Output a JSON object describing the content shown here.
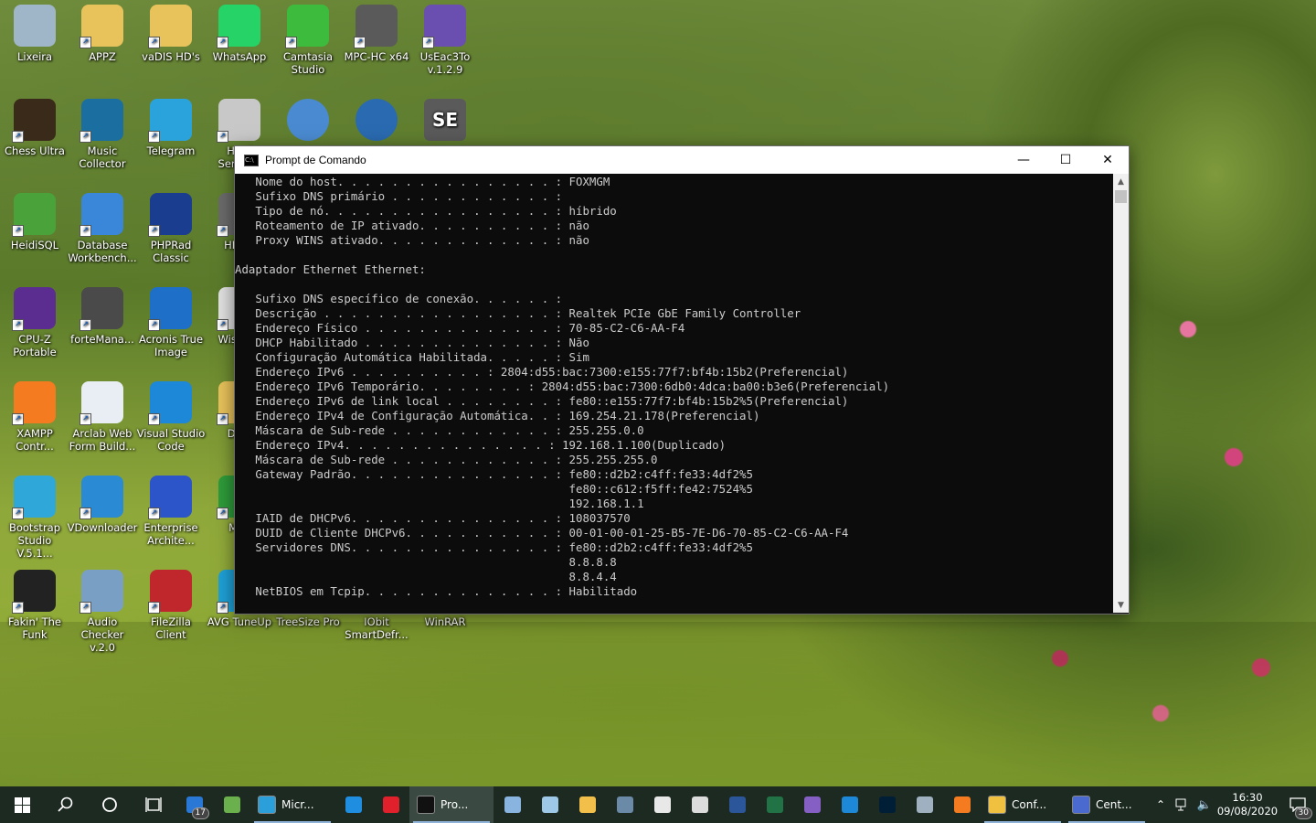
{
  "desktop": {
    "icons": [
      {
        "label": "Lixeira",
        "icon": "recycle-bin-icon",
        "color": "#9fb6c8"
      },
      {
        "label": "APPZ",
        "icon": "folder-icon",
        "color": "#e8c25a"
      },
      {
        "label": "vaDIS HD's",
        "icon": "folder-icon",
        "color": "#e8c25a"
      },
      {
        "label": "WhatsApp",
        "icon": "whatsapp-icon",
        "color": "#25d366"
      },
      {
        "label": "Camtasia Studio",
        "icon": "camtasia-icon",
        "color": "#3dbb3d"
      },
      {
        "label": "MPC-HC x64",
        "icon": "mpc-hc-icon",
        "color": "#5a5a5a"
      },
      {
        "label": "UsEac3To v.1.2.9",
        "icon": "useac3to-icon",
        "color": "#6a4fb0"
      },
      {
        "label": "Chess Ultra",
        "icon": "chess-icon",
        "color": "#3a2a1a"
      },
      {
        "label": "Music Collector",
        "icon": "music-collector-icon",
        "color": "#1a6fa0"
      },
      {
        "label": "Telegram",
        "icon": "telegram-icon",
        "color": "#2aa3dd"
      },
      {
        "label": "Hard Sentinel",
        "icon": "hard-disk-sentinel-icon",
        "color": "#c8c8c8"
      },
      {
        "label": "HeidiSQL",
        "icon": "heidisql-icon",
        "color": "#4aa33a"
      },
      {
        "label": "Database Workbench...",
        "icon": "database-workbench-icon",
        "color": "#3a86d9"
      },
      {
        "label": "PHPRad Classic",
        "icon": "phprad-icon",
        "color": "#1a3d8f"
      },
      {
        "label": "HD Tu",
        "icon": "hd-tune-icon",
        "color": "#6a6a6a"
      },
      {
        "label": "CPU-Z Portable",
        "icon": "cpu-z-icon",
        "color": "#5b2d91"
      },
      {
        "label": "forteMana...",
        "icon": "forte-manager-icon",
        "color": "#4a4a4a"
      },
      {
        "label": "Acronis True Image",
        "icon": "acronis-icon",
        "color": "#1e6fc7"
      },
      {
        "label": "Wise De",
        "icon": "wise-icon",
        "color": "#e0e0e0"
      },
      {
        "label": "XAMPP Contr...",
        "icon": "xampp-icon",
        "color": "#f47b20"
      },
      {
        "label": "Arclab Web Form Build...",
        "icon": "arclab-icon",
        "color": "#e8eef4"
      },
      {
        "label": "Visual Studio Code",
        "icon": "vscode-icon",
        "color": "#1e88d8"
      },
      {
        "label": "DirLi",
        "icon": "folder-icon",
        "color": "#e8c25a"
      },
      {
        "label": "Bootstrap Studio V.5.1...",
        "icon": "bootstrap-studio-icon",
        "color": "#2fa8d9"
      },
      {
        "label": "VDownloader",
        "icon": "vdownloader-icon",
        "color": "#2a8ad4"
      },
      {
        "label": "Enterprise Archite...",
        "icon": "enterprise-architect-icon",
        "color": "#2b55c9"
      },
      {
        "label": "Mak",
        "icon": "mak-icon",
        "color": "#2e9b3a"
      },
      {
        "label": "Fakin' The Funk",
        "icon": "fakin-the-funk-icon",
        "color": "#222222"
      },
      {
        "label": "Audio Checker v.2.0",
        "icon": "audio-checker-icon",
        "color": "#7a9fc4"
      },
      {
        "label": "FileZilla Client",
        "icon": "filezilla-icon",
        "color": "#c0272d"
      },
      {
        "label": "AVG TuneUp",
        "icon": "avg-tuneup-icon",
        "color": "#1ea0d6"
      },
      {
        "label": "TreeSize Pro",
        "icon": "treesize-icon",
        "color": "#4a8a2a"
      },
      {
        "label": "IObit SmartDefr...",
        "icon": "smart-defrag-icon",
        "color": "#3a7ab5"
      },
      {
        "label": "WinRAR",
        "icon": "winrar-icon",
        "color": "#8a3a7a"
      }
    ],
    "partial_icons": [
      {
        "icon": "media-player-icon",
        "color": "#4a8ad0"
      },
      {
        "icon": "media-center-icon",
        "color": "#2a6ab0"
      },
      {
        "icon": "se-explorer-icon",
        "color": "#5a5a5a",
        "text": "SE"
      }
    ]
  },
  "window": {
    "title": "Prompt de Comando",
    "minimize": "—",
    "maximize": "☐",
    "close": "✕",
    "lines": [
      "   Nome do host. . . . . . . . . . . . . . . . : FOXMGM",
      "   Sufixo DNS primário . . . . . . . . . . . . :",
      "   Tipo de nó. . . . . . . . . . . . . . . . . : híbrido",
      "   Roteamento de IP ativado. . . . . . . . . . : não",
      "   Proxy WINS ativado. . . . . . . . . . . . . : não",
      "",
      "Adaptador Ethernet Ethernet:",
      "",
      "   Sufixo DNS específico de conexão. . . . . . :",
      "   Descrição . . . . . . . . . . . . . . . . . : Realtek PCIe GbE Family Controller",
      "   Endereço Físico . . . . . . . . . . . . . . : 70-85-C2-C6-AA-F4",
      "   DHCP Habilitado . . . . . . . . . . . . . . : Não",
      "   Configuração Automática Habilitada. . . . . : Sim",
      "   Endereço IPv6 . . . . . . . . . . : 2804:d55:bac:7300:e155:77f7:bf4b:15b2(Preferencial)",
      "   Endereço IPv6 Temporário. . . . . . . . : 2804:d55:bac:7300:6db0:4dca:ba00:b3e6(Preferencial)",
      "   Endereço IPv6 de link local . . . . . . . . : fe80::e155:77f7:bf4b:15b2%5(Preferencial)",
      "   Endereço IPv4 de Configuração Automática. . : 169.254.21.178(Preferencial)",
      "   Máscara de Sub-rede . . . . . . . . . . . . : 255.255.0.0",
      "   Endereço IPv4. . . . . . . . . . . . . . . : 192.168.1.100(Duplicado)",
      "   Máscara de Sub-rede . . . . . . . . . . . . : 255.255.255.0",
      "   Gateway Padrão. . . . . . . . . . . . . . . : fe80::d2b2:c4ff:fe33:4df2%5",
      "                                                 fe80::c612:f5ff:fe42:7524%5",
      "                                                 192.168.1.1",
      "   IAID de DHCPv6. . . . . . . . . . . . . . . : 108037570",
      "   DUID de Cliente DHCPv6. . . . . . . . . . . : 00-01-00-01-25-B5-7E-D6-70-85-C2-C6-AA-F4",
      "   Servidores DNS. . . . . . . . . . . . . . . : fe80::d2b2:c4ff:fe33:4df2%5",
      "                                                 8.8.8.8",
      "                                                 8.8.4.4",
      "   NetBIOS em Tcpip. . . . . . . . . . . . . . : Habilitado"
    ]
  },
  "taskbar": {
    "start_icon": "windows-start-icon",
    "search_icon": "search-icon",
    "cortana_icon": "cortana-icon",
    "taskview_icon": "task-view-icon",
    "mail_badge": "17",
    "edge_label": "Micr...",
    "cmd_label": "Pro...",
    "settings_label": "Conf...",
    "central_label": "Cent...",
    "time": "16:30",
    "date": "09/08/2020",
    "notification_count": "30",
    "pinned": [
      {
        "icon": "mail-icon",
        "color": "#2a78d6"
      },
      {
        "icon": "utorrent-icon",
        "color": "#6ab04c"
      },
      {
        "icon": "edge-icon",
        "color": "#2b9fd9"
      },
      {
        "icon": "internet-explorer-icon",
        "color": "#1f8de0"
      },
      {
        "icon": "opera-icon",
        "color": "#e0202b"
      },
      {
        "icon": "cmd-icon",
        "color": "#111111"
      },
      {
        "icon": "notepad-icon",
        "color": "#8ab4e0"
      },
      {
        "icon": "paint-icon",
        "color": "#9ec8e8"
      },
      {
        "icon": "file-explorer-icon",
        "color": "#f2c04a"
      },
      {
        "icon": "calculator-icon",
        "color": "#6a8aa8"
      },
      {
        "icon": "fox-icon",
        "color": "#e8e8e8"
      },
      {
        "icon": "alien-icon",
        "color": "#dcdcdc"
      },
      {
        "icon": "word-icon",
        "color": "#2b579a"
      },
      {
        "icon": "excel-icon",
        "color": "#217346"
      },
      {
        "icon": "visual-studio-icon",
        "color": "#865fc5"
      },
      {
        "icon": "vscode-taskbar-icon",
        "color": "#1e88d8"
      },
      {
        "icon": "photoshop-icon",
        "color": "#001e36"
      },
      {
        "icon": "tool-icon",
        "color": "#9fb0c0"
      },
      {
        "icon": "xampp-taskbar-icon",
        "color": "#f47b20"
      },
      {
        "icon": "settings-app-icon",
        "color": "#f0c040"
      }
    ]
  }
}
